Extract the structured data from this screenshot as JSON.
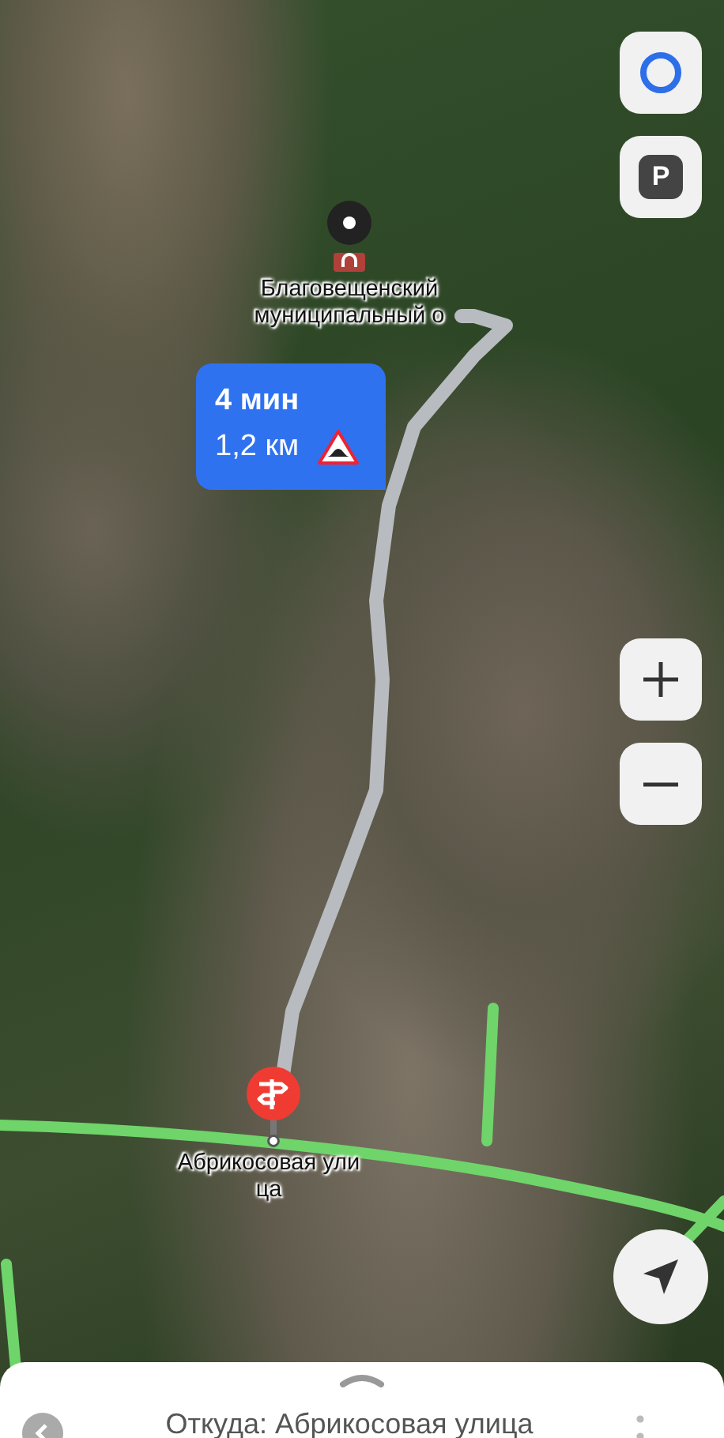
{
  "map": {
    "places": [
      {
        "kind": "poi",
        "label": "Благовещенский муниципальный о"
      },
      {
        "kind": "destination",
        "label": "Абрикосовая улица"
      }
    ],
    "route_bubble": {
      "time": "4 мин",
      "distance": "1,2 км"
    },
    "controls": {
      "parking": "P"
    }
  },
  "bottom_sheet": {
    "title": "Откуда: Абрикосовая улица"
  }
}
